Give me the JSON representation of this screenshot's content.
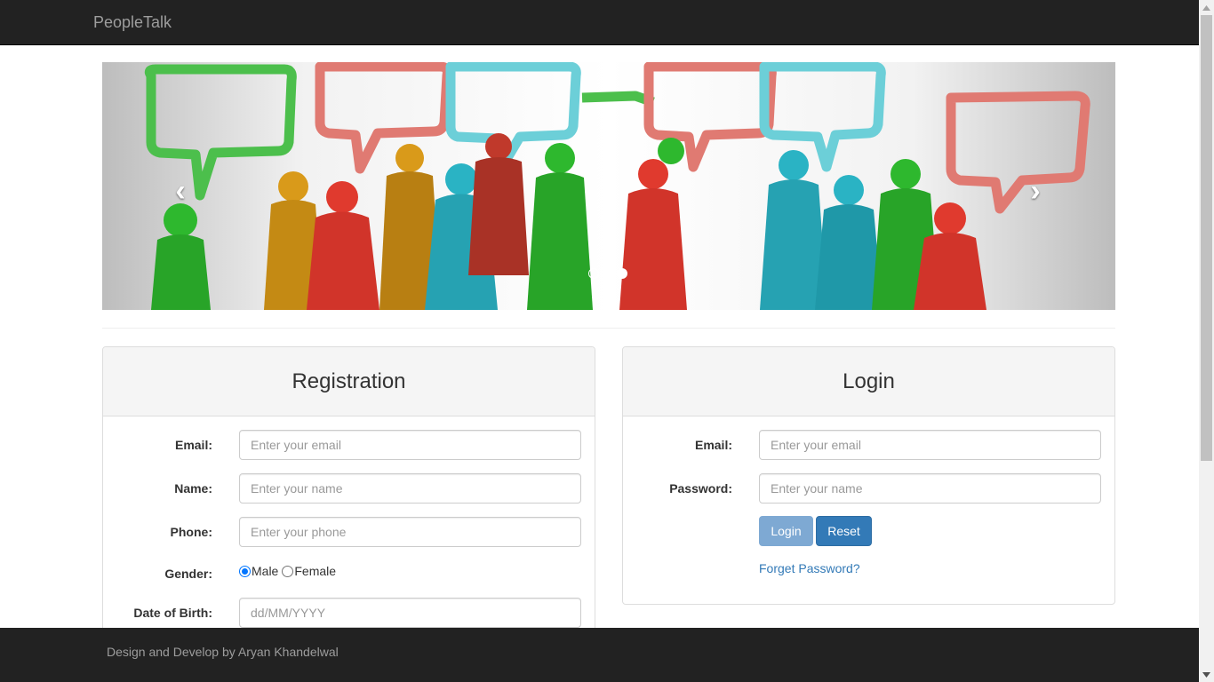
{
  "navbar": {
    "brand": "PeopleTalk"
  },
  "carousel": {
    "prev_icon": "chevron-left-icon",
    "next_icon": "chevron-right-icon",
    "indicators": [
      {
        "active": false
      },
      {
        "active": false
      },
      {
        "active": true
      }
    ]
  },
  "registration": {
    "title": "Registration",
    "email": {
      "label": "Email:",
      "placeholder": "Enter your email",
      "value": ""
    },
    "name": {
      "label": "Name:",
      "placeholder": "Enter your name",
      "value": ""
    },
    "phone": {
      "label": "Phone:",
      "placeholder": "Enter your phone",
      "value": ""
    },
    "gender": {
      "label": "Gender:",
      "options": [
        "Male",
        "Female"
      ],
      "selected": "Male"
    },
    "dob": {
      "label": "Date of Birth:",
      "placeholder": "dd/MM/YYYY",
      "value": ""
    }
  },
  "login": {
    "title": "Login",
    "email": {
      "label": "Email:",
      "placeholder": "Enter your email",
      "value": ""
    },
    "password": {
      "label": "Password:",
      "placeholder": "Enter your name",
      "value": ""
    },
    "login_button": "Login",
    "reset_button": "Reset",
    "forgot_link": "Forget Password?"
  },
  "footer": {
    "text": "Design and Develop by Aryan Khandelwal"
  },
  "colors": {
    "navbar_bg": "#222222",
    "navbar_text": "#9d9d9d",
    "primary": "#337ab7",
    "primary_disabled": "#7ea9d3",
    "panel_heading_bg": "#f5f5f5"
  }
}
